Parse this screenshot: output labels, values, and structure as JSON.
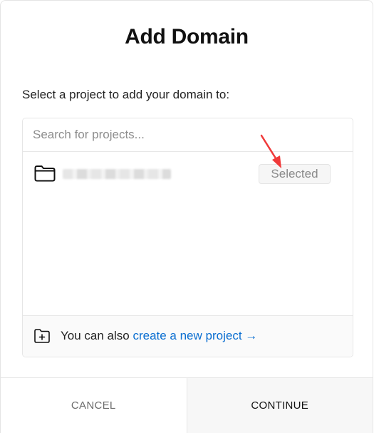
{
  "dialog": {
    "title": "Add Domain",
    "subtitle": "Select a project to add your domain to:"
  },
  "search": {
    "placeholder": "Search for projects...",
    "value": ""
  },
  "projects": [
    {
      "name_blurred": true,
      "icon": "folder-icon",
      "status_label": "Selected"
    }
  ],
  "footer_note": {
    "icon": "add-folder-icon",
    "prefix": "You can also ",
    "link_label": "create a new project →"
  },
  "actions": {
    "cancel_label": "CANCEL",
    "continue_label": "CONTINUE"
  },
  "colors": {
    "link": "#0a6ed1",
    "annotation_arrow": "#f03a3a"
  }
}
